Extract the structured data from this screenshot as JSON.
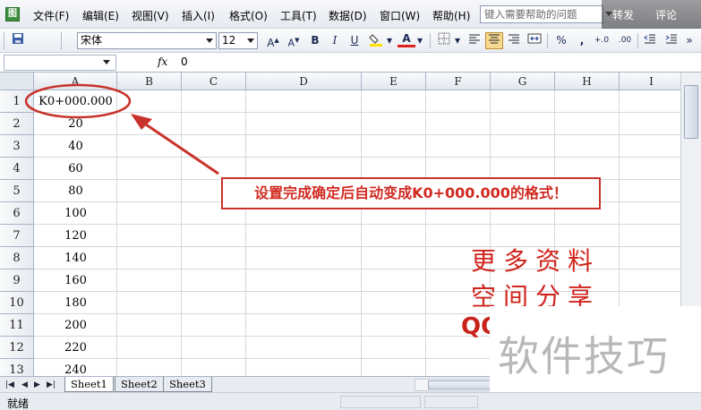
{
  "menubar": {
    "app_icon": "excel-icon",
    "items": [
      "文件(F)",
      "编辑(E)",
      "视图(V)",
      "插入(I)",
      "格式(O)",
      "工具(T)",
      "数据(D)",
      "窗口(W)",
      "帮助(H)"
    ],
    "help_placeholder": "键入需要帮助的问题",
    "overlay_left": "转发",
    "overlay_right": "评论"
  },
  "toolbar": {
    "font_name": "宋体",
    "font_size": "12",
    "grow_font": "A",
    "shrink_font": "A",
    "bold": "B",
    "italic": "I",
    "underline": "U",
    "font_color_glyph": "A",
    "percent": "%",
    "comma": ",",
    "inc_decimal": "+.0",
    "dec_decimal": ".00",
    "colors": {
      "fill": "#ffe000",
      "font": "#e02020"
    }
  },
  "formula_bar": {
    "name_box": "",
    "fx": "fx",
    "value": "0"
  },
  "grid": {
    "columns": [
      "A",
      "B",
      "C",
      "D",
      "E",
      "F",
      "G",
      "H",
      "I"
    ],
    "rows": [
      "1",
      "2",
      "3",
      "4",
      "5",
      "6",
      "7",
      "8",
      "9",
      "10",
      "11",
      "12",
      "13"
    ],
    "column_a_values": [
      "K0+000.000",
      "20",
      "40",
      "60",
      "80",
      "100",
      "120",
      "140",
      "160",
      "180",
      "200",
      "220",
      "240"
    ]
  },
  "sheet_tabs": {
    "nav": [
      "|◀",
      "◀",
      "▶",
      "▶|"
    ],
    "tabs": [
      "Sheet1",
      "Sheet2",
      "Sheet3"
    ],
    "active": "Sheet1"
  },
  "status_bar": {
    "text": "就绪"
  },
  "annotation": {
    "callout": "设置完成确定后自动变成K0+000.000的格式！",
    "promo_line1": "更多资料",
    "promo_line2": "空间分享",
    "qq": "QQ",
    "watermark": "软件技巧",
    "accent_color": "#d02a20"
  }
}
